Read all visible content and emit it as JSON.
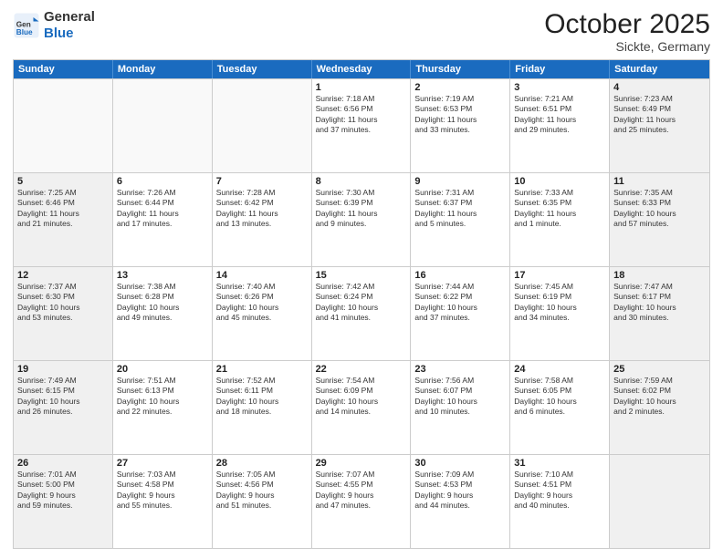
{
  "header": {
    "logo_general": "General",
    "logo_blue": "Blue",
    "month": "October 2025",
    "location": "Sickte, Germany"
  },
  "days_of_week": [
    "Sunday",
    "Monday",
    "Tuesday",
    "Wednesday",
    "Thursday",
    "Friday",
    "Saturday"
  ],
  "rows": [
    [
      {
        "day": "",
        "lines": [],
        "empty": true
      },
      {
        "day": "",
        "lines": [],
        "empty": true
      },
      {
        "day": "",
        "lines": [],
        "empty": true
      },
      {
        "day": "1",
        "lines": [
          "Sunrise: 7:18 AM",
          "Sunset: 6:56 PM",
          "Daylight: 11 hours",
          "and 37 minutes."
        ]
      },
      {
        "day": "2",
        "lines": [
          "Sunrise: 7:19 AM",
          "Sunset: 6:53 PM",
          "Daylight: 11 hours",
          "and 33 minutes."
        ]
      },
      {
        "day": "3",
        "lines": [
          "Sunrise: 7:21 AM",
          "Sunset: 6:51 PM",
          "Daylight: 11 hours",
          "and 29 minutes."
        ]
      },
      {
        "day": "4",
        "lines": [
          "Sunrise: 7:23 AM",
          "Sunset: 6:49 PM",
          "Daylight: 11 hours",
          "and 25 minutes."
        ],
        "shaded": true
      }
    ],
    [
      {
        "day": "5",
        "lines": [
          "Sunrise: 7:25 AM",
          "Sunset: 6:46 PM",
          "Daylight: 11 hours",
          "and 21 minutes."
        ],
        "shaded": true
      },
      {
        "day": "6",
        "lines": [
          "Sunrise: 7:26 AM",
          "Sunset: 6:44 PM",
          "Daylight: 11 hours",
          "and 17 minutes."
        ]
      },
      {
        "day": "7",
        "lines": [
          "Sunrise: 7:28 AM",
          "Sunset: 6:42 PM",
          "Daylight: 11 hours",
          "and 13 minutes."
        ]
      },
      {
        "day": "8",
        "lines": [
          "Sunrise: 7:30 AM",
          "Sunset: 6:39 PM",
          "Daylight: 11 hours",
          "and 9 minutes."
        ]
      },
      {
        "day": "9",
        "lines": [
          "Sunrise: 7:31 AM",
          "Sunset: 6:37 PM",
          "Daylight: 11 hours",
          "and 5 minutes."
        ]
      },
      {
        "day": "10",
        "lines": [
          "Sunrise: 7:33 AM",
          "Sunset: 6:35 PM",
          "Daylight: 11 hours",
          "and 1 minute."
        ]
      },
      {
        "day": "11",
        "lines": [
          "Sunrise: 7:35 AM",
          "Sunset: 6:33 PM",
          "Daylight: 10 hours",
          "and 57 minutes."
        ],
        "shaded": true
      }
    ],
    [
      {
        "day": "12",
        "lines": [
          "Sunrise: 7:37 AM",
          "Sunset: 6:30 PM",
          "Daylight: 10 hours",
          "and 53 minutes."
        ],
        "shaded": true
      },
      {
        "day": "13",
        "lines": [
          "Sunrise: 7:38 AM",
          "Sunset: 6:28 PM",
          "Daylight: 10 hours",
          "and 49 minutes."
        ]
      },
      {
        "day": "14",
        "lines": [
          "Sunrise: 7:40 AM",
          "Sunset: 6:26 PM",
          "Daylight: 10 hours",
          "and 45 minutes."
        ]
      },
      {
        "day": "15",
        "lines": [
          "Sunrise: 7:42 AM",
          "Sunset: 6:24 PM",
          "Daylight: 10 hours",
          "and 41 minutes."
        ]
      },
      {
        "day": "16",
        "lines": [
          "Sunrise: 7:44 AM",
          "Sunset: 6:22 PM",
          "Daylight: 10 hours",
          "and 37 minutes."
        ]
      },
      {
        "day": "17",
        "lines": [
          "Sunrise: 7:45 AM",
          "Sunset: 6:19 PM",
          "Daylight: 10 hours",
          "and 34 minutes."
        ]
      },
      {
        "day": "18",
        "lines": [
          "Sunrise: 7:47 AM",
          "Sunset: 6:17 PM",
          "Daylight: 10 hours",
          "and 30 minutes."
        ],
        "shaded": true
      }
    ],
    [
      {
        "day": "19",
        "lines": [
          "Sunrise: 7:49 AM",
          "Sunset: 6:15 PM",
          "Daylight: 10 hours",
          "and 26 minutes."
        ],
        "shaded": true
      },
      {
        "day": "20",
        "lines": [
          "Sunrise: 7:51 AM",
          "Sunset: 6:13 PM",
          "Daylight: 10 hours",
          "and 22 minutes."
        ]
      },
      {
        "day": "21",
        "lines": [
          "Sunrise: 7:52 AM",
          "Sunset: 6:11 PM",
          "Daylight: 10 hours",
          "and 18 minutes."
        ]
      },
      {
        "day": "22",
        "lines": [
          "Sunrise: 7:54 AM",
          "Sunset: 6:09 PM",
          "Daylight: 10 hours",
          "and 14 minutes."
        ]
      },
      {
        "day": "23",
        "lines": [
          "Sunrise: 7:56 AM",
          "Sunset: 6:07 PM",
          "Daylight: 10 hours",
          "and 10 minutes."
        ]
      },
      {
        "day": "24",
        "lines": [
          "Sunrise: 7:58 AM",
          "Sunset: 6:05 PM",
          "Daylight: 10 hours",
          "and 6 minutes."
        ]
      },
      {
        "day": "25",
        "lines": [
          "Sunrise: 7:59 AM",
          "Sunset: 6:02 PM",
          "Daylight: 10 hours",
          "and 2 minutes."
        ],
        "shaded": true
      }
    ],
    [
      {
        "day": "26",
        "lines": [
          "Sunrise: 7:01 AM",
          "Sunset: 5:00 PM",
          "Daylight: 9 hours",
          "and 59 minutes."
        ],
        "shaded": true
      },
      {
        "day": "27",
        "lines": [
          "Sunrise: 7:03 AM",
          "Sunset: 4:58 PM",
          "Daylight: 9 hours",
          "and 55 minutes."
        ]
      },
      {
        "day": "28",
        "lines": [
          "Sunrise: 7:05 AM",
          "Sunset: 4:56 PM",
          "Daylight: 9 hours",
          "and 51 minutes."
        ]
      },
      {
        "day": "29",
        "lines": [
          "Sunrise: 7:07 AM",
          "Sunset: 4:55 PM",
          "Daylight: 9 hours",
          "and 47 minutes."
        ]
      },
      {
        "day": "30",
        "lines": [
          "Sunrise: 7:09 AM",
          "Sunset: 4:53 PM",
          "Daylight: 9 hours",
          "and 44 minutes."
        ]
      },
      {
        "day": "31",
        "lines": [
          "Sunrise: 7:10 AM",
          "Sunset: 4:51 PM",
          "Daylight: 9 hours",
          "and 40 minutes."
        ]
      },
      {
        "day": "",
        "lines": [],
        "empty": true,
        "shaded": true
      }
    ]
  ]
}
